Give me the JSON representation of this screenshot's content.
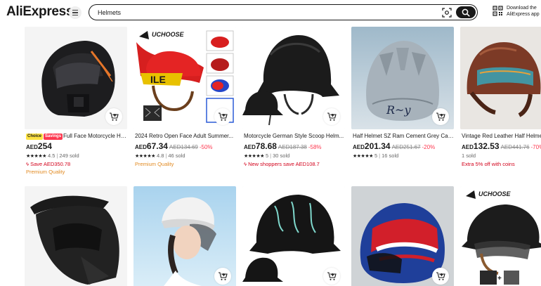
{
  "header": {
    "logo": "AliExpress",
    "search_value": "Helmets",
    "download_line1": "Download the",
    "download_line2": "AliExpress app"
  },
  "products": [
    {
      "badges": [
        "Choice",
        "Savings"
      ],
      "title": "Full Face Motorcycle He...",
      "currency": "AED",
      "price": "254",
      "original_price": "",
      "discount": "",
      "rating": "4.5",
      "sold": "249 sold",
      "promo": "Save AED350.78",
      "promo_color": "#d3031c",
      "extra": "Premium Quality"
    },
    {
      "badges": [],
      "title": "2024 Retro Open Face Adult Summer...",
      "currency": "AED",
      "price": "67.34",
      "original_price": "AED134.69",
      "discount": "-50%",
      "rating": "4.8",
      "sold": "46 sold",
      "promo": "Premium Quality",
      "promo_color": "#e28b23",
      "extra": "",
      "logo_text": "UCHOOSE"
    },
    {
      "badges": [],
      "title": "Motorcycle German Style Scoop Helm...",
      "currency": "AED",
      "price": "78.68",
      "original_price": "AED187.38",
      "discount": "-58%",
      "rating": "5",
      "sold": "30 sold",
      "promo": "New shoppers save AED108.7",
      "promo_color": "#d3031c",
      "extra": ""
    },
    {
      "badges": [],
      "title": "Half Helmet SZ Ram Cement Grey Cas...",
      "currency": "AED",
      "price": "201.34",
      "original_price": "AED251.67",
      "discount": "-20%",
      "rating": "5",
      "sold": "16 sold",
      "promo": "",
      "promo_color": "#d3031c",
      "extra": ""
    },
    {
      "badges": [],
      "title": "Vintage Red Leather Half Helmet...",
      "currency": "AED",
      "price": "132.53",
      "original_price": "AED441.76",
      "discount": "-70%",
      "rating": "",
      "sold": "1 sold",
      "promo": "Extra 5% off with coins",
      "promo_color": "#d3031c",
      "extra": ""
    }
  ],
  "second_row_logo": "UCHOOSE",
  "colors": {
    "brand_red": "#fd384f",
    "price_black": "#191919",
    "premium_orange": "#e28b23"
  }
}
